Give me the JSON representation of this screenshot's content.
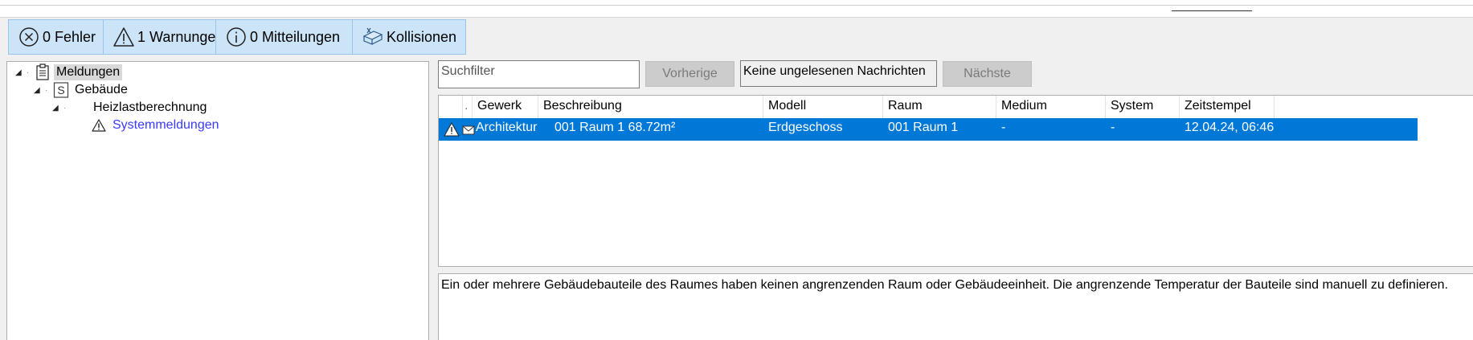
{
  "toolbar": {
    "errors_label": "0 Fehler",
    "warnings_label": "1 Warnungen",
    "info_label": "0 Mitteilungen",
    "collisions_label": "Kollisionen",
    "icons": [
      "error-circle-icon",
      "warning-triangle-icon",
      "info-circle-icon",
      "collision-icon"
    ]
  },
  "tree": {
    "root": {
      "label": "Meldungen",
      "icon": "clipboard-icon"
    },
    "building": {
      "label": "Gebäude",
      "icon_letter": "S"
    },
    "calc": {
      "label": "Heizlastberechnung"
    },
    "system": {
      "label": "Systemmeldungen",
      "icon": "warning-triangle-icon"
    }
  },
  "search": {
    "placeholder": "Suchfilter"
  },
  "nav": {
    "previous_label": "Vorherige",
    "status_text": "Keine ungelesenen Nachrichten",
    "next_label": "Nächste"
  },
  "table": {
    "columns": [
      "Gewerk",
      "Beschreibung",
      "Modell",
      "Raum",
      "Medium",
      "System",
      "Zeitstempel"
    ],
    "rows": [
      {
        "icons": [
          "warning-triangle-icon",
          "envelope-icon"
        ],
        "cells": [
          "Architektur",
          "001 Raum 1 68.72m²",
          "Erdgeschoss",
          "001 Raum 1",
          "-",
          "-",
          "12.04.24, 06:46"
        ]
      }
    ]
  },
  "description": "Ein oder mehrere Gebäudebauteile des Raumes haben keinen angrenzenden Raum oder Gebäudeeinheit. Die angrenzende Temperatur der Bauteile sind manuell zu definieren.",
  "colors": {
    "toolbar_bg": "#cce4f7",
    "selection": "#0078d7",
    "link": "#3a3aff"
  }
}
